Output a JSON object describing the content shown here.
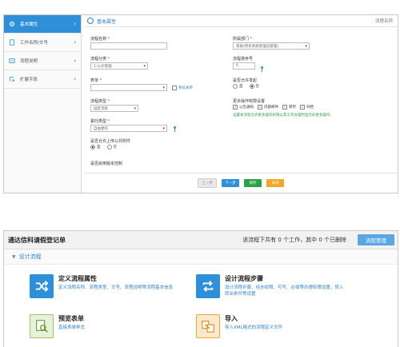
{
  "top": {
    "sidebar": [
      {
        "label": "基本属性",
        "icon": "gear-icon"
      },
      {
        "label": "工作名称/文号",
        "icon": "document-icon"
      },
      {
        "label": "流程说明",
        "icon": "info-icon"
      },
      {
        "label": "扩展字段",
        "icon": "extension-icon"
      }
    ],
    "section_title": "基本属性",
    "status": "流程名称",
    "fields": {
      "flow_name": "流程名称",
      "flow_category": "流程分类",
      "flow_category_value": "1-公文管理",
      "form": "表单",
      "view_form": "预览表单",
      "flow_type": "流程类型",
      "flow_type_value": "固定流程",
      "order_type": "委托类型",
      "order_type_value": "自由委托",
      "attach": "是否允许上传公共附件",
      "yes": "是",
      "no": "否",
      "doc_control": "是否启用版本控制",
      "dept": "所属部门",
      "dept_value": "系统(所有系统管理员管理)",
      "sort_no": "流程排序号",
      "sort_no_value": "0",
      "auto_gen": "是否允许发起",
      "ops": "更多操作权限设置",
      "op_items": [
        "公告通知",
        "内部邮件",
        "转存",
        "归档"
      ],
      "note": "设置本流程允许更多操作权限以及工作办理时显示的更多操作。"
    },
    "buttons": {
      "prev": "上一步",
      "next": "下一步",
      "save": "保存",
      "close": "关闭"
    }
  },
  "bottom": {
    "title": "通达信科请假登记单",
    "info": "该流程下共有 0 个工作，其中 0 个已删除",
    "config_button": "流程管理",
    "section": "设计流程",
    "cards": [
      {
        "title": "定义流程属性",
        "desc": "定义流程名称、流程类型、文号、流程说明等流程基本信息",
        "icon": "shuffle-icon"
      },
      {
        "title": "设计流程步骤",
        "desc": "设计流程步骤、经办权限、可写、必填等办理权限设置，转入转出条件等设置",
        "icon": "repeat-icon"
      },
      {
        "title": "预览表单",
        "desc": "直接表单样式",
        "icon": "preview-icon"
      },
      {
        "title": "导入",
        "desc": "导入XML格式的流程定义文件",
        "icon": "import-icon"
      }
    ]
  }
}
